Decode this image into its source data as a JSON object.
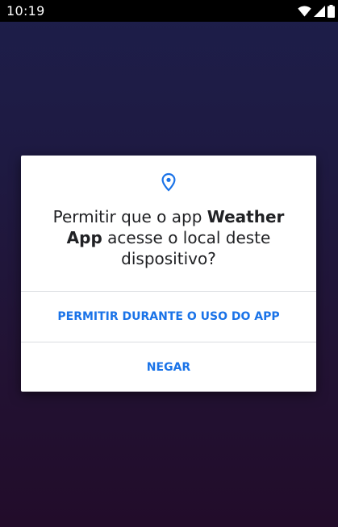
{
  "status_bar": {
    "time": "10:19",
    "icons": [
      "wifi-icon",
      "cellular-signal-icon",
      "battery-icon"
    ]
  },
  "dialog": {
    "icon": "location-pin-icon",
    "title_prefix": "Permitir que o app ",
    "app_name": "Weather App",
    "title_suffix": " acesse o local deste dispositivo?",
    "allow_label": "PERMITIR DURANTE O USO DO APP",
    "deny_label": "NEGAR"
  },
  "colors": {
    "accent": "#1a73e8",
    "background_top": "#1d1e4a",
    "background_bottom": "#220c2a",
    "dialog_background": "#ffffff",
    "title_text": "#202124"
  }
}
